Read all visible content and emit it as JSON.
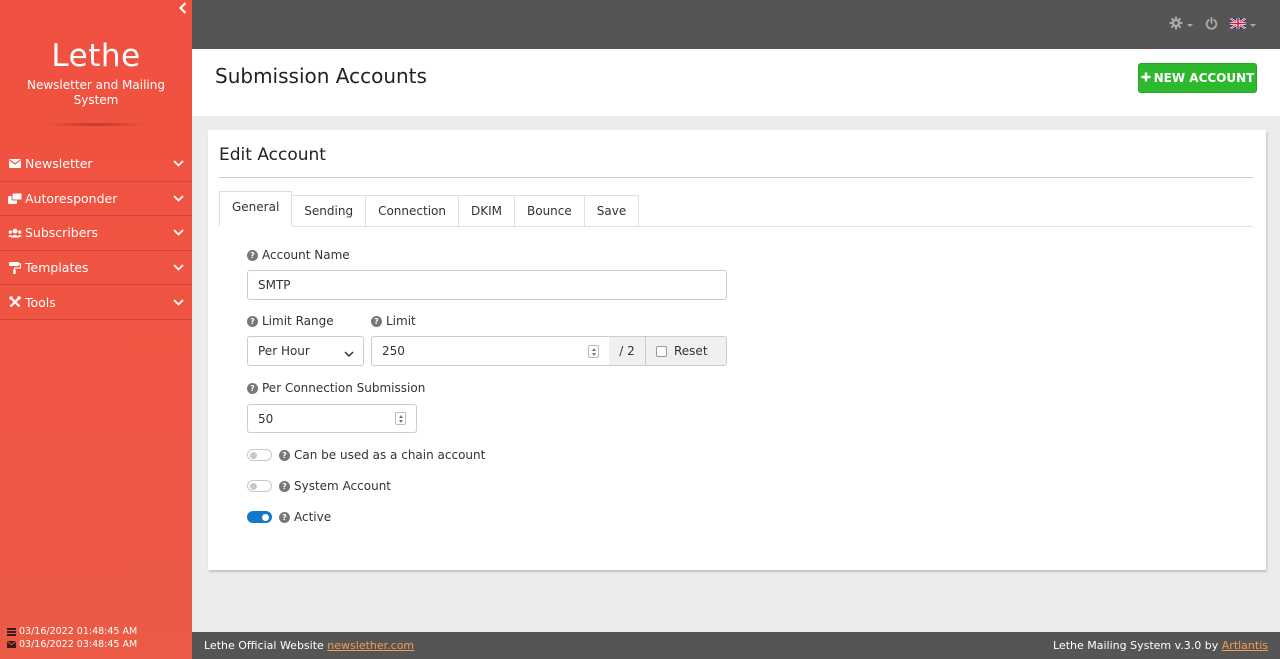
{
  "sidebar": {
    "brand_title": "Lethe",
    "brand_subtitle": "Newsletter and Mailing System",
    "items": [
      {
        "label": "Newsletter",
        "icon": "envelope-icon"
      },
      {
        "label": "Autoresponder",
        "icon": "autoresponder-icon"
      },
      {
        "label": "Subscribers",
        "icon": "users-icon"
      },
      {
        "label": "Templates",
        "icon": "paint-roller-icon"
      },
      {
        "label": "Tools",
        "icon": "tools-icon"
      }
    ],
    "footer": {
      "server_time": "03/16/2022 01:48:45 AM",
      "mail_time": "03/16/2022 03:48:45 AM"
    }
  },
  "header": {
    "title": "Submission Accounts",
    "new_button": "NEW ACCOUNT"
  },
  "card": {
    "title": "Edit Account",
    "tabs": [
      "General",
      "Sending",
      "Connection",
      "DKIM",
      "Bounce",
      "Save"
    ],
    "active_tab": "General"
  },
  "form": {
    "account_name_label": "Account Name",
    "account_name_value": "SMTP",
    "limit_range_label": "Limit Range",
    "limit_range_value": "Per Hour",
    "limit_label": "Limit",
    "limit_value": "250",
    "limit_divisor": "/ 2",
    "reset_label": "Reset",
    "per_connection_label": "Per Connection Submission",
    "per_connection_value": "50",
    "chain_label": "Can be used as a chain account",
    "chain_enabled": false,
    "system_label": "System Account",
    "system_enabled": false,
    "active_label": "Active",
    "active_enabled": true
  },
  "footer": {
    "left_text": "Lethe Official Website",
    "left_link": "newslether.com",
    "right_text": "Lethe Mailing System v.3.0 by",
    "right_link": "Artlantis"
  },
  "colors": {
    "sidebar": "#f0503f",
    "topbar": "#555555",
    "primary_button": "#2eb82e",
    "toggle_on": "#1479c8",
    "link": "#f39c52"
  }
}
